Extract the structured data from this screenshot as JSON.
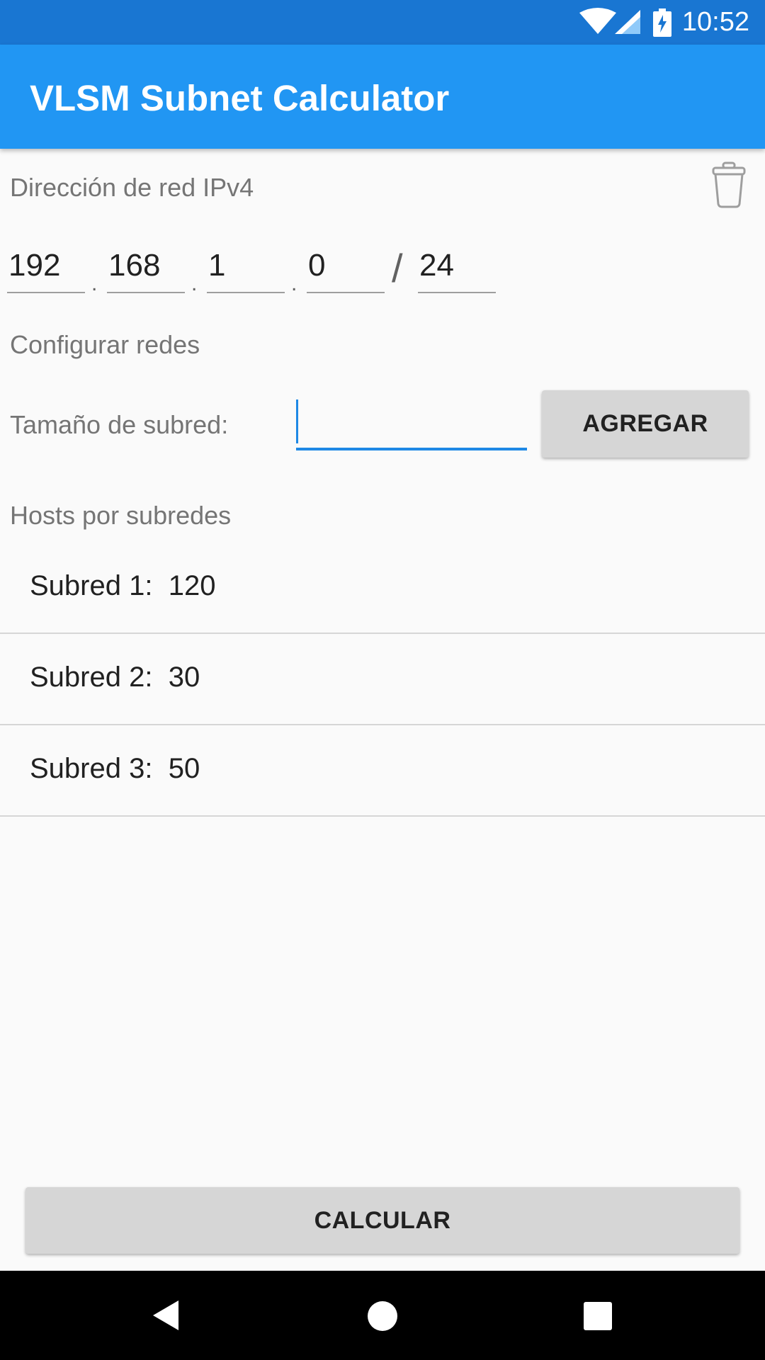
{
  "status_bar": {
    "time": "10:52",
    "icons": [
      "wifi-icon",
      "signal-icon",
      "battery-charging-icon"
    ]
  },
  "app_bar": {
    "title": "VLSM Subnet Calculator",
    "color": "#2196f3"
  },
  "network": {
    "label": "Dirección de red IPv4",
    "octets": [
      "192",
      "168",
      "1",
      "0"
    ],
    "prefix": "24",
    "dot": ".",
    "slash": "/"
  },
  "configure": {
    "label": "Configurar redes",
    "subnet_size_label": "Tamaño de subred:",
    "subnet_size_value": "",
    "add_button": "AGREGAR"
  },
  "hosts": {
    "label": "Hosts por subredes",
    "items": [
      {
        "name": "Subred 1:",
        "value": "120"
      },
      {
        "name": "Subred 2:",
        "value": "30"
      },
      {
        "name": "Subred 3:",
        "value": "50"
      }
    ]
  },
  "calculate_button": "CALCULAR",
  "nav_bar": {
    "buttons": [
      "back-icon",
      "home-icon",
      "recents-icon"
    ]
  },
  "colors": {
    "status_bar": "#1976d2",
    "app_bar": "#2196f3",
    "accent": "#1e88e5"
  }
}
